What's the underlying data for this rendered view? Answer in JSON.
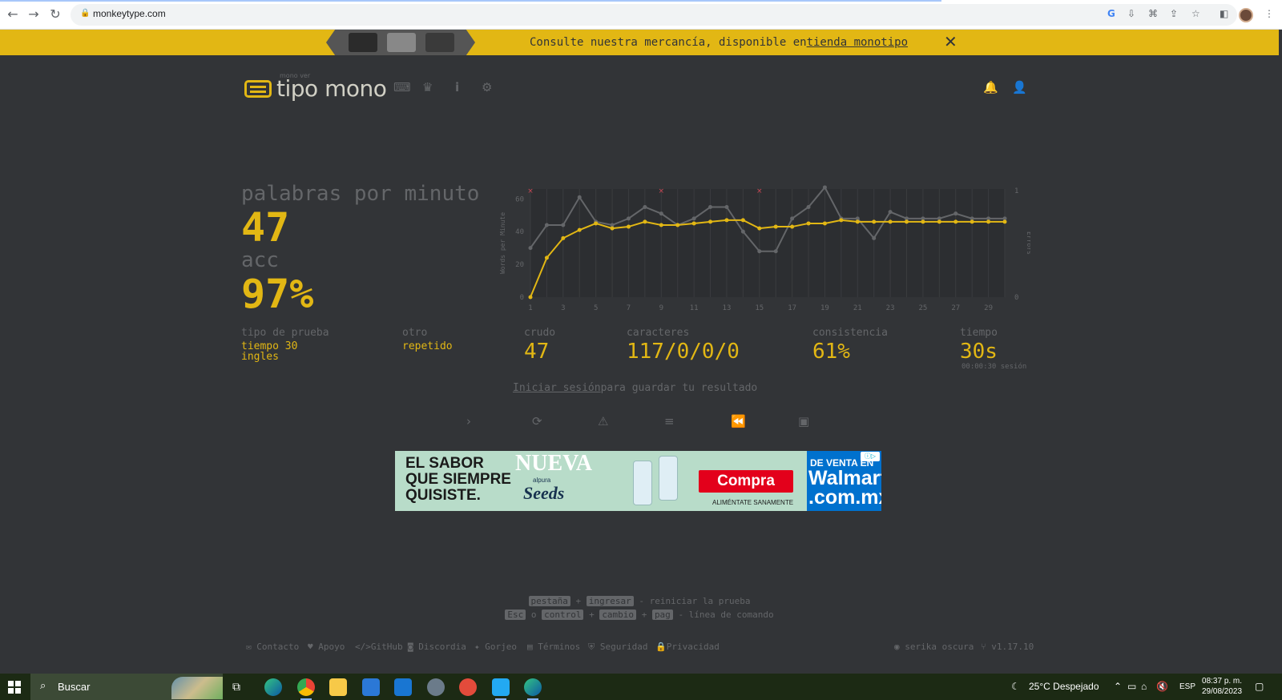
{
  "browser": {
    "url": "monkeytype.com"
  },
  "banner": {
    "text": "Consulte nuestra mercancía, disponible en",
    "link": "tienda monotipo",
    "close_glyph": "✕"
  },
  "header": {
    "logo_top": "mono ver",
    "logo_text": "tipo mono",
    "nav_icons": [
      "keyboard-icon",
      "crown-icon",
      "info-icon",
      "gear-icon"
    ],
    "right_icons": [
      "bell-icon",
      "user-icon"
    ]
  },
  "result": {
    "wpm_label": "palabras por minuto",
    "wpm_value": "47",
    "acc_label": "acc",
    "acc_value": "97%",
    "test_type_label": "tipo de prueba",
    "test_type_value_1": "tiempo 30",
    "test_type_value_2": "ingles",
    "other_label": "otro",
    "other_value": "repetido",
    "raw_label": "crudo",
    "raw_value": "47",
    "chars_label": "caracteres",
    "chars_value": "117/0/0/0",
    "consistency_label": "consistencia",
    "consistency_value": "61%",
    "time_label": "tiempo",
    "time_value": "30s",
    "session_note": "00:00:30 sesión",
    "login_link": "Iniciar sesión",
    "login_rest": "para guardar tu resultado"
  },
  "actions": {
    "icons": [
      "next-test-icon",
      "restart-icon",
      "warning-icon",
      "words-history-icon",
      "replay-icon",
      "screenshot-icon"
    ]
  },
  "ad": {
    "headline": "EL SABOR\nQUE SIEMPRE\nQUISISTE.",
    "nueva": "NUEVA",
    "brand_small": "alpura",
    "brand": "Seeds",
    "cta": "Compra",
    "tagline": "ALIMÉNTATE SANAMENTE",
    "walmart_top": "DE VENTA EN",
    "walmart_main": "Walmart\n.com.mx"
  },
  "hints": {
    "line1_keys": [
      "pestaña",
      "ingresar"
    ],
    "line1_sep": "+",
    "line1_text": "- reiniciar la prueba",
    "line2_keys": [
      "Esc",
      "control",
      "cambio",
      "pag"
    ],
    "line2_or": "o",
    "line2_plus": "+",
    "line2_text": "- línea de comando"
  },
  "footer": {
    "links": [
      "Contacto",
      "Apoyo",
      "GitHub",
      "Discordia",
      "Gorjeo",
      "Términos",
      "Seguridad",
      "Privacidad"
    ],
    "theme": "serika oscura",
    "version": "v1.17.10"
  },
  "chart_data": {
    "type": "line",
    "x": [
      1,
      2,
      3,
      4,
      5,
      6,
      7,
      8,
      9,
      10,
      11,
      12,
      13,
      14,
      15,
      16,
      17,
      18,
      19,
      20,
      21,
      22,
      23,
      24,
      25,
      26,
      27,
      28,
      29,
      30
    ],
    "xticks": [
      1,
      3,
      5,
      7,
      9,
      11,
      13,
      15,
      17,
      19,
      21,
      23,
      25,
      27,
      29
    ],
    "yticks": [
      0,
      20,
      40,
      60
    ],
    "y2ticks": [
      0,
      1
    ],
    "ylabel": "Words per Minute",
    "y2label": "Errors",
    "ylim": [
      0,
      66
    ],
    "series": [
      {
        "name": "wpm",
        "color": "#e2b714",
        "values": [
          0,
          24,
          36,
          41,
          45,
          42,
          43,
          46,
          44,
          44,
          45,
          46,
          47,
          47,
          42,
          43,
          43,
          45,
          45,
          47,
          46,
          46,
          46,
          46,
          46,
          46,
          46,
          46,
          46,
          46
        ]
      },
      {
        "name": "raw",
        "color": "#646669",
        "values": [
          30,
          44,
          44,
          61,
          46,
          44,
          48,
          55,
          51,
          44,
          48,
          55,
          55,
          40,
          28,
          28,
          48,
          55,
          67,
          48,
          48,
          36,
          52,
          48,
          48,
          48,
          51,
          48,
          48,
          48
        ]
      }
    ],
    "errors_at": [
      1,
      9,
      15
    ],
    "grid": true,
    "legend": "none"
  },
  "taskbar": {
    "search_placeholder": "Buscar",
    "weather": "25°C  Despejado",
    "lang": "ESP",
    "time": "08:37 p. m.",
    "date": "29/08/2023"
  },
  "colors": {
    "bg": "#323437",
    "main": "#e2b714",
    "sub": "#646669",
    "text": "#d1d0c5"
  }
}
